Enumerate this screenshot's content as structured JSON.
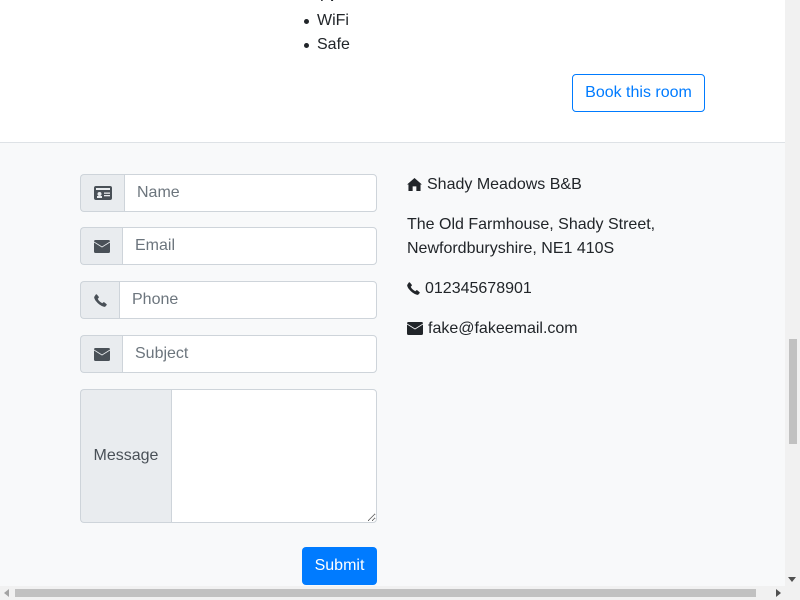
{
  "room": {
    "amenities": [
      "TV",
      "WiFi",
      "Safe"
    ],
    "book_label": "Book this room"
  },
  "contact_form": {
    "name_placeholder": "Name",
    "email_placeholder": "Email",
    "phone_placeholder": "Phone",
    "subject_placeholder": "Subject",
    "message_label": "Message",
    "submit_label": "Submit"
  },
  "contact_info": {
    "business_name": "Shady Meadows B&B",
    "address_line1": "The Old Farmhouse, Shady Street,",
    "address_line2": "Newfordburyshire, NE1 410S",
    "phone": "012345678901",
    "email": "fake@fakeemail.com"
  },
  "icons": {
    "name": "id-card-icon",
    "email": "envelope-icon",
    "phone": "phone-icon",
    "subject": "envelope-icon",
    "business": "home-icon"
  },
  "colors": {
    "primary": "#007bff",
    "section_bg": "#f8f9fa",
    "addon_bg": "#e9ecef"
  }
}
